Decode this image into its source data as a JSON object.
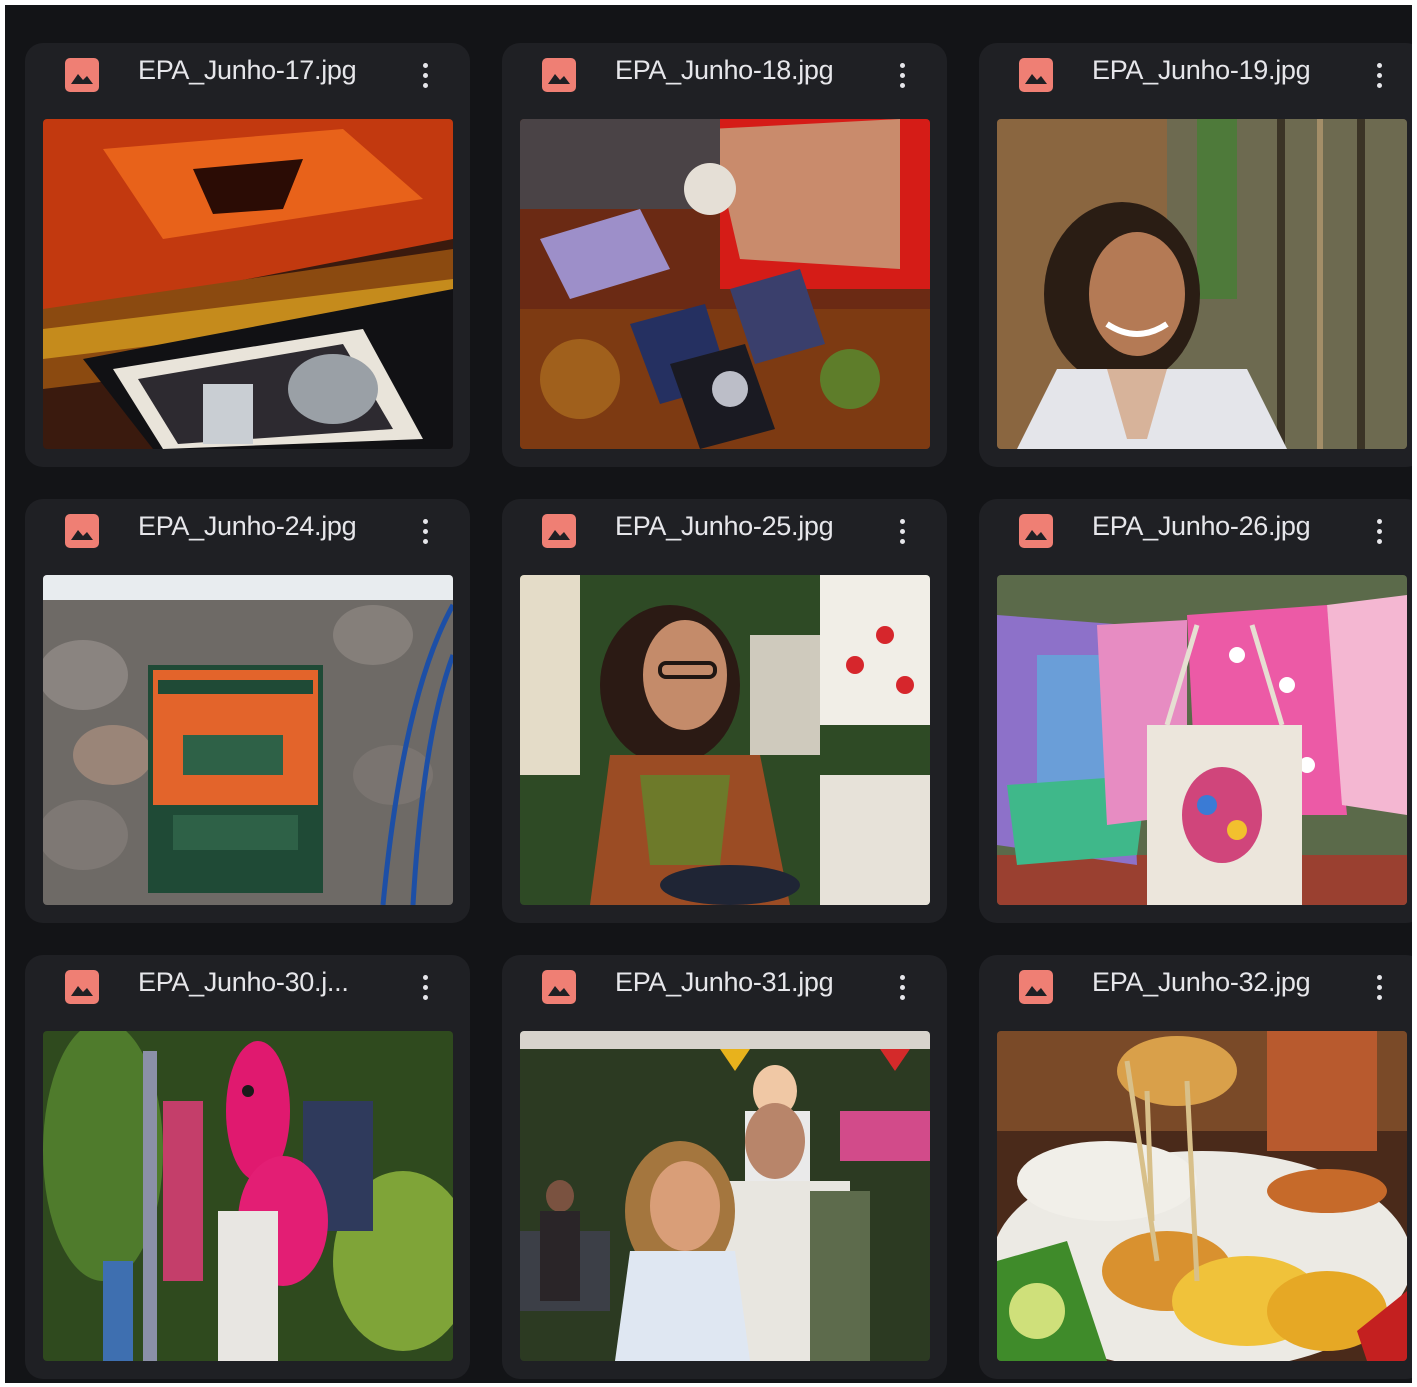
{
  "files": [
    {
      "name": "EPA_Junho-17.jpg",
      "icon": "image-file-icon",
      "thumbnail": "tarot-cards-red-cloth"
    },
    {
      "name": "EPA_Junho-18.jpg",
      "icon": "image-file-icon",
      "thumbnail": "tarot-spread-crystal-ball"
    },
    {
      "name": "EPA_Junho-19.jpg",
      "icon": "image-file-icon",
      "thumbnail": "smiling-woman-bamboo-fence"
    },
    {
      "name": "EPA_Junho-24.jpg",
      "icon": "image-file-icon",
      "thumbnail": "banner-on-stone-wall"
    },
    {
      "name": "EPA_Junho-25.jpg",
      "icon": "image-file-icon",
      "thumbnail": "woman-with-glasses-market"
    },
    {
      "name": "EPA_Junho-26.jpg",
      "icon": "image-file-icon",
      "thumbnail": "hanging-dresses-tote-bag"
    },
    {
      "name": "EPA_Junho-30.j...",
      "icon": "image-file-icon",
      "thumbnail": "pink-fabric-fish"
    },
    {
      "name": "EPA_Junho-31.jpg",
      "icon": "image-file-icon",
      "thumbnail": "family-child-on-shoulders"
    },
    {
      "name": "EPA_Junho-32.jpg",
      "icon": "image-file-icon",
      "thumbnail": "fried-food-fries-plate"
    }
  ],
  "colors": {
    "background": "#131417",
    "card": "#1f2024",
    "file_icon": "#ef7f74",
    "text": "#e6e6ea"
  }
}
